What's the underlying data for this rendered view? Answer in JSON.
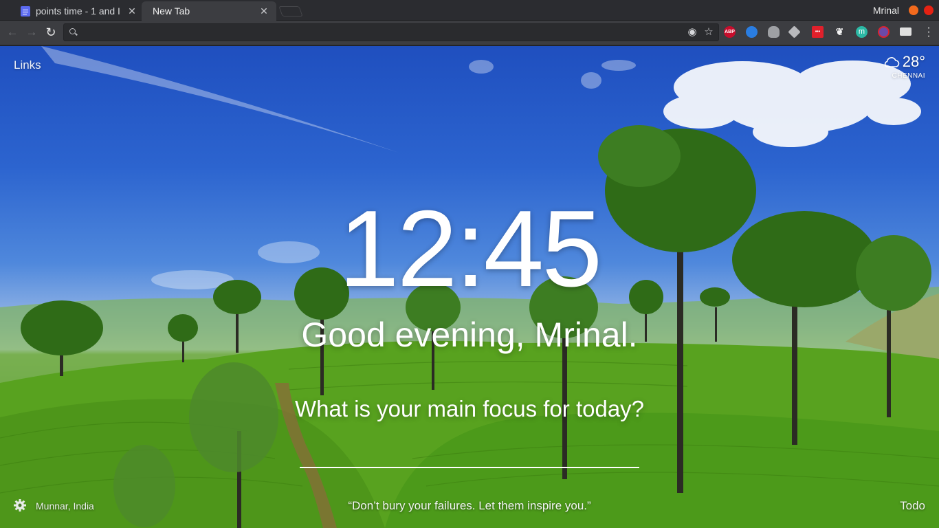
{
  "window": {
    "profile_name": "Mrinal",
    "tabs": [
      {
        "label": "points time - 1 and I",
        "active": false
      },
      {
        "label": "New Tab",
        "active": true
      }
    ]
  },
  "toolbar": {
    "omnibox_value": "",
    "extensions": [
      {
        "icon": "adblock-plus-icon",
        "label": "ABP",
        "color": "#c70d2c"
      },
      {
        "icon": "extension-icon-blue",
        "color": "#2a7de1"
      },
      {
        "icon": "extension-icon-grey",
        "color": "#9ea0a4"
      },
      {
        "icon": "extension-icon-layers",
        "color": "#b9babd"
      },
      {
        "icon": "extension-icon-red-dots",
        "color": "#e0202b"
      },
      {
        "icon": "extension-icon-gnome",
        "color": "#f4f4f4"
      },
      {
        "icon": "momentum-icon",
        "label": "m",
        "color": "#2bb8a4"
      },
      {
        "icon": "extension-icon-block",
        "color": "#d9232f"
      },
      {
        "icon": "extension-icon-card",
        "color": "#e0e0e0"
      }
    ]
  },
  "dashboard": {
    "links_label": "Links",
    "weather": {
      "temperature": "28°",
      "city": "CHENNAI",
      "icon": "cloud-icon"
    },
    "clock": "12:45",
    "greeting": "Good evening, Mrinal.",
    "focus_question": "What is your main focus for today?",
    "focus_value": "",
    "photo_location": "Munnar, India",
    "quote": "“Don’t bury your failures. Let them inspire you.”",
    "todo_label": "Todo"
  }
}
